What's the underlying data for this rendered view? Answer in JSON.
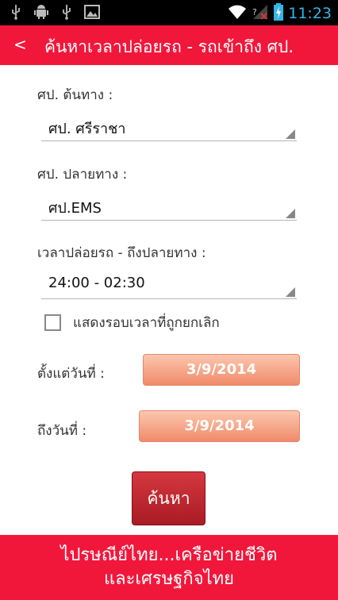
{
  "status_bar": {
    "time": "11:23",
    "left_icons": [
      "usb-icon",
      "android-debug-icon",
      "usb-icon",
      "image-icon"
    ],
    "right_icons": [
      "wifi-icon",
      "no-signal-icon",
      "battery-charging-icon"
    ]
  },
  "action_bar": {
    "back_label": "<",
    "title": "ค้นหาเวลาปล่อยรถ - รถเข้าถึง ศป."
  },
  "form": {
    "origin": {
      "label": "ศป. ต้นทาง :",
      "value": "ศป. ศรีราชา"
    },
    "destination": {
      "label": "ศป. ปลายทาง :",
      "value": "ศป.EMS"
    },
    "time_range": {
      "label": "เวลาปล่อยรถ - ถึงปลายทาง :",
      "value": "24:00 - 02:30"
    },
    "show_cancelled": {
      "label": "แสดงรอบเวลาที่ถูกยกเลิก",
      "checked": false
    },
    "from_date": {
      "label": "ตั้งแต่วันที่ :",
      "value": "3/9/2014"
    },
    "to_date": {
      "label": "ถึงวันที่ :",
      "value": "3/9/2014"
    },
    "search_label": "ค้นหา"
  },
  "footer": {
    "line1": "ไปรษณีย์ไทย...เครือข่ายชีวิต",
    "line2": "และเศรษฐกิจไทย"
  },
  "colors": {
    "brand_red": "#f1173b",
    "date_button": "#f4a283",
    "search_button": "#bb2730",
    "clock": "#33b5e5"
  }
}
